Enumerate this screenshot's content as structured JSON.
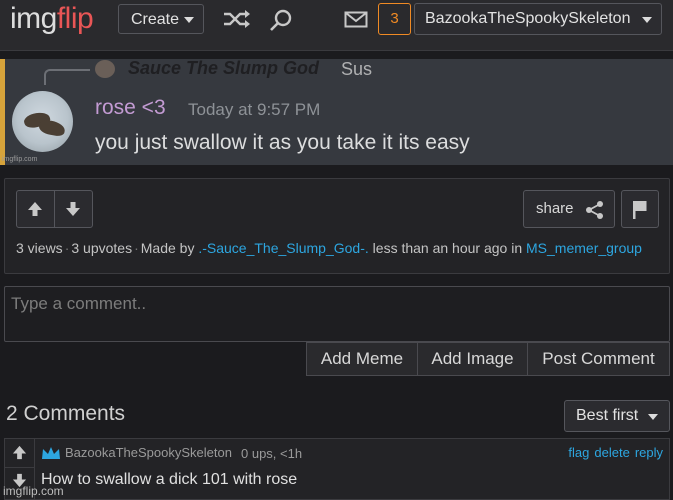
{
  "nav": {
    "logo_img": "img",
    "logo_flip": "flip",
    "create_label": "Create",
    "notification_count": "3",
    "username": "BazookaTheSpookySkeleton"
  },
  "meme": {
    "reply_author": "Sauce The Slump God",
    "reply_text": "Sus",
    "author": "rose <3",
    "timestamp": "Today at 9:57 PM",
    "message": "you just swallow it as you take it its easy",
    "watermark": "imgflip.com"
  },
  "post": {
    "share_label": "share",
    "views": "3 views",
    "upvotes": "3 upvotes",
    "made_by_prefix": "Made by",
    "author": ".-Sauce_The_Slump_God-.",
    "time_in": "less than an hour ago in",
    "stream": "MS_memer_group"
  },
  "comment_form": {
    "placeholder": "Type a comment..",
    "add_meme": "Add Meme",
    "add_image": "Add Image",
    "post_comment": "Post Comment"
  },
  "comments": {
    "title": "2 Comments",
    "sort_label": "Best first",
    "items": [
      {
        "user": "BazookaTheSpookySkeleton",
        "meta": "0 ups, <1h",
        "flag": "flag",
        "delete": "delete",
        "reply": "reply",
        "text": "How to swallow a dick 101 with rose"
      }
    ]
  },
  "footer_watermark": "imgflip.com",
  "colors": {
    "accent_link": "#2da6e0",
    "brand_red": "#e95656",
    "notif_orange": "#f08a24"
  },
  "icons": [
    "shuffle-icon",
    "search-icon",
    "mail-icon",
    "share-icon",
    "flag-icon",
    "upvote-icon",
    "downvote-icon",
    "crown-icon"
  ]
}
